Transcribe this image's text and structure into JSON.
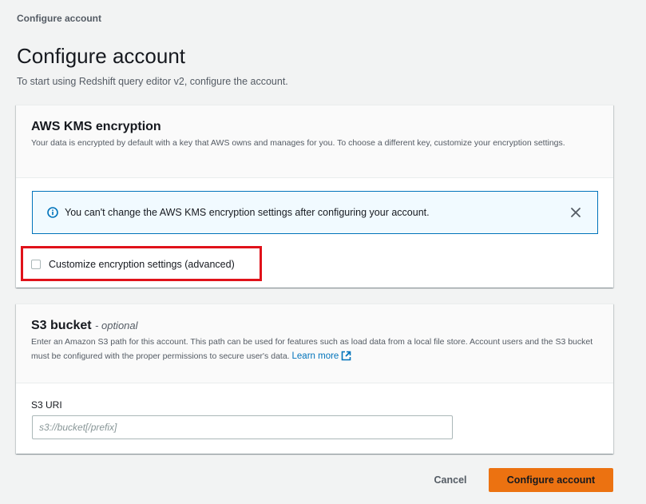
{
  "breadcrumb": "Configure account",
  "page": {
    "title": "Configure account",
    "subtitle": "To start using Redshift query editor v2, configure the account."
  },
  "kms": {
    "title": "AWS KMS encryption",
    "description": "Your data is encrypted by default with a key that AWS owns and manages for you. To choose a different key, customize your encryption settings.",
    "alert_text": "You can't change the AWS KMS encryption settings after configuring your account.",
    "checkbox_label": "Customize encryption settings (advanced)",
    "checkbox_checked": false
  },
  "s3": {
    "title": "S3 bucket",
    "optional_label": "- optional",
    "description": "Enter an Amazon S3 path for this account. This path can be used for features such as load data from a local file store. Account users and the S3 bucket must be configured with the proper permissions to secure user's data.",
    "learn_more": "Learn more",
    "uri_label": "S3 URI",
    "uri_value": "",
    "uri_placeholder": "s3://bucket[/prefix]"
  },
  "actions": {
    "cancel_label": "Cancel",
    "configure_label": "Configure account"
  },
  "colors": {
    "primary": "#ec7211",
    "link": "#0073bb",
    "highlight": "#e0121a",
    "info_bg": "#f1faff"
  },
  "icons": {
    "info": "info-icon",
    "close": "close-icon",
    "external": "external-link-icon"
  }
}
